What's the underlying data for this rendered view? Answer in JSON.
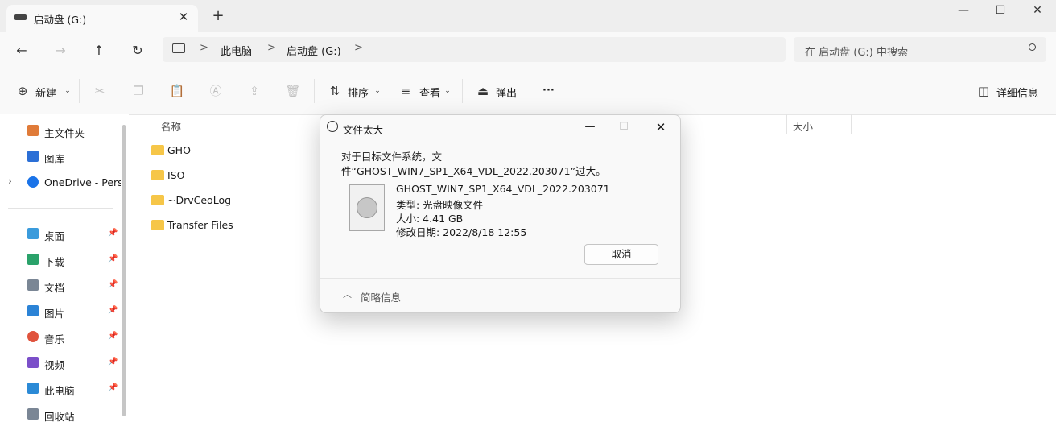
{
  "tab": {
    "title": "启动盘 (G:)",
    "close": "✕",
    "new": "+"
  },
  "window": {
    "minimize": "—",
    "maximize": "☐",
    "close": "✕"
  },
  "nav": {
    "back": "←",
    "forward": "→",
    "up": "↑",
    "refresh": "↻"
  },
  "breadcrumb": {
    "sep": ">",
    "items": [
      "此电脑",
      "启动盘 (G:)"
    ]
  },
  "search": {
    "placeholder": "在 启动盘 (G:) 中搜索"
  },
  "toolbar": {
    "new_label": "新建",
    "sort_label": "排序",
    "view_label": "查看",
    "eject_label": "弹出",
    "more": "···",
    "details_label": "详细信息"
  },
  "sidebar": {
    "top_items": [
      {
        "label": "主文件夹",
        "icon": "home-icon",
        "color": "#e07b39"
      },
      {
        "label": "图库",
        "icon": "gallery-icon",
        "color": "#2b6fd6"
      },
      {
        "label": "OneDrive - Perso",
        "icon": "cloud-icon",
        "color": "#1a73e8"
      }
    ],
    "pinned_items": [
      {
        "label": "桌面",
        "icon": "desktop-icon",
        "color": "#3a9bdc"
      },
      {
        "label": "下载",
        "icon": "download-icon",
        "color": "#2aa26a"
      },
      {
        "label": "文档",
        "icon": "document-icon",
        "color": "#7a8695"
      },
      {
        "label": "图片",
        "icon": "pictures-icon",
        "color": "#2b83d6"
      },
      {
        "label": "音乐",
        "icon": "music-icon",
        "color": "#e0533d"
      },
      {
        "label": "视频",
        "icon": "video-icon",
        "color": "#7b4fc9"
      },
      {
        "label": "此电脑",
        "icon": "this-pc-icon",
        "color": "#2b8ad6"
      },
      {
        "label": "回收站",
        "icon": "recycle-bin-icon",
        "color": "#7a8695"
      }
    ]
  },
  "columns": {
    "name": "名称",
    "size": "大小"
  },
  "files": [
    {
      "name": "GHO",
      "type": "folder"
    },
    {
      "name": "ISO",
      "type": "folder"
    },
    {
      "name": "~DrvCeoLog",
      "type": "folder"
    },
    {
      "name": "Transfer Files",
      "type": "folder"
    }
  ],
  "dialog": {
    "title": "文件太大",
    "message": "对于目标文件系统，文件“GHOST_WIN7_SP1_X64_VDL_2022.203071”过大。",
    "file_name": "GHOST_WIN7_SP1_X64_VDL_2022.203071",
    "file_type": "类型: 光盘映像文件",
    "file_size": "大小: 4.41 GB",
    "file_date": "修改日期: 2022/8/18 12:55",
    "cancel_label": "取消",
    "details_label": "简略信息",
    "minimize": "—",
    "maximize": "☐",
    "close": "✕"
  }
}
